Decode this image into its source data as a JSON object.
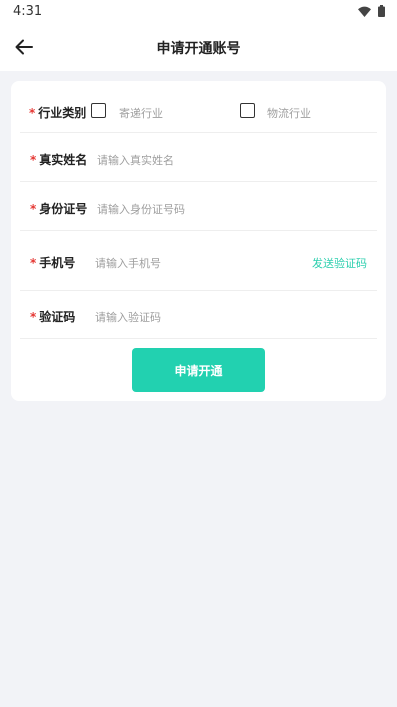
{
  "status_bar": {
    "time": "4:31",
    "icons": [
      "wifi-icon",
      "battery-icon"
    ]
  },
  "app_bar": {
    "back_icon": "arrow-left-icon",
    "title": "申请开通账号"
  },
  "form": {
    "industry": {
      "required_mark": "*",
      "label": "行业类别",
      "options": [
        {
          "label": "寄递行业",
          "checked": false
        },
        {
          "label": "物流行业",
          "checked": false
        }
      ]
    },
    "real_name": {
      "required_mark": "*",
      "label": "真实姓名",
      "placeholder": "请输入真实姓名"
    },
    "id_number": {
      "required_mark": "*",
      "label": "身份证号",
      "placeholder": "请输入身份证号码"
    },
    "phone": {
      "required_mark": "*",
      "label": "手机号",
      "placeholder": "请输入手机号",
      "send_code_label": "发送验证码"
    },
    "verify_code": {
      "required_mark": "*",
      "label": "验证码",
      "placeholder": "请输入验证码"
    },
    "submit_label": "申请开通"
  },
  "colors": {
    "accent": "#22d1b0",
    "link": "#2ccfae",
    "required": "#e53935",
    "background": "#f2f3f7"
  }
}
